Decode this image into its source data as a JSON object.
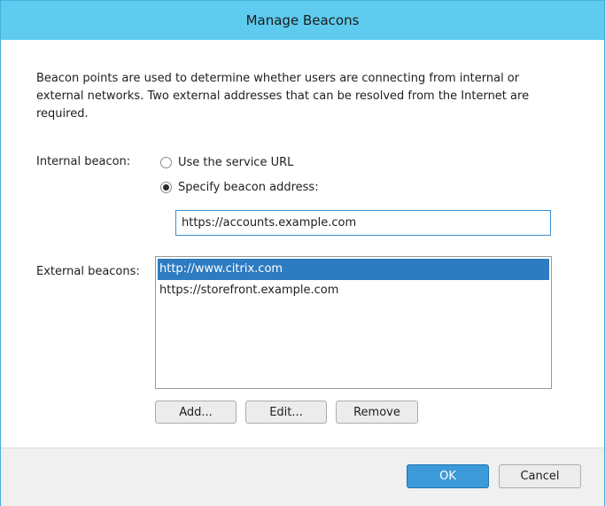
{
  "dialog": {
    "title": "Manage Beacons",
    "intro": "Beacon points are used to determine whether users are connecting from internal or external networks. Two external addresses that can be resolved from the Internet are required."
  },
  "internal": {
    "label": "Internal beacon:",
    "option_service_url": "Use the service URL",
    "option_specify": "Specify beacon address:",
    "selected_option": "Specify beacon address:",
    "address_value": "https://accounts.example.com"
  },
  "external": {
    "label": "External beacons:",
    "items": [
      {
        "text": "http://www.citrix.com",
        "selected": true
      },
      {
        "text": "https://storefront.example.com",
        "selected": false
      }
    ],
    "add_label": "Add...",
    "edit_label": "Edit...",
    "remove_label": "Remove"
  },
  "footer": {
    "ok_label": "OK",
    "cancel_label": "Cancel"
  },
  "colors": {
    "titlebar": "#5ecbef",
    "selection": "#2d7bc1",
    "primary_button": "#3b9ad7"
  }
}
